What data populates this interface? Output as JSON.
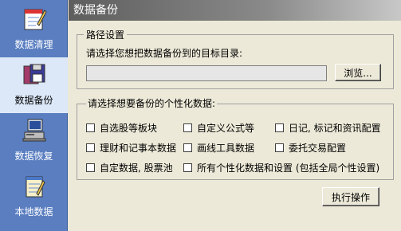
{
  "sidebar": {
    "items": [
      {
        "label": "数据清理",
        "icon": "notepad-pencil-icon"
      },
      {
        "label": "数据备份",
        "icon": "floppy-disk-icon"
      },
      {
        "label": "数据恢复",
        "icon": "computer-restore-icon"
      },
      {
        "label": "本地数据",
        "icon": "notepad-icon"
      }
    ],
    "active_index": 1
  },
  "panel": {
    "title": "数据备份",
    "path_group": {
      "legend": "路径设置",
      "prompt": "请选择您想把数据备份到的目标目录:",
      "path_value": "",
      "browse_label": "浏览..."
    },
    "data_group": {
      "prompt": "请选择想要备份的个性化数据:",
      "options": [
        {
          "label": "自选股等板块",
          "checked": false
        },
        {
          "label": "自定义公式等",
          "checked": false
        },
        {
          "label": "日记, 标记和资讯配置",
          "checked": false
        },
        {
          "label": "理财和记事本数据",
          "checked": false
        },
        {
          "label": "画线工具数据",
          "checked": false
        },
        {
          "label": "委托交易配置",
          "checked": false
        },
        {
          "label": "自定数据, 股票池",
          "checked": false
        },
        {
          "label": "所有个性化数据和设置 (包括全局个性设置)",
          "checked": false
        }
      ]
    },
    "execute_label": "执行操作"
  },
  "colors": {
    "sidebar_bg": "#5a7ec0",
    "active_item_bg": "#dce8f8",
    "panel_bg": "#ece9d8"
  }
}
